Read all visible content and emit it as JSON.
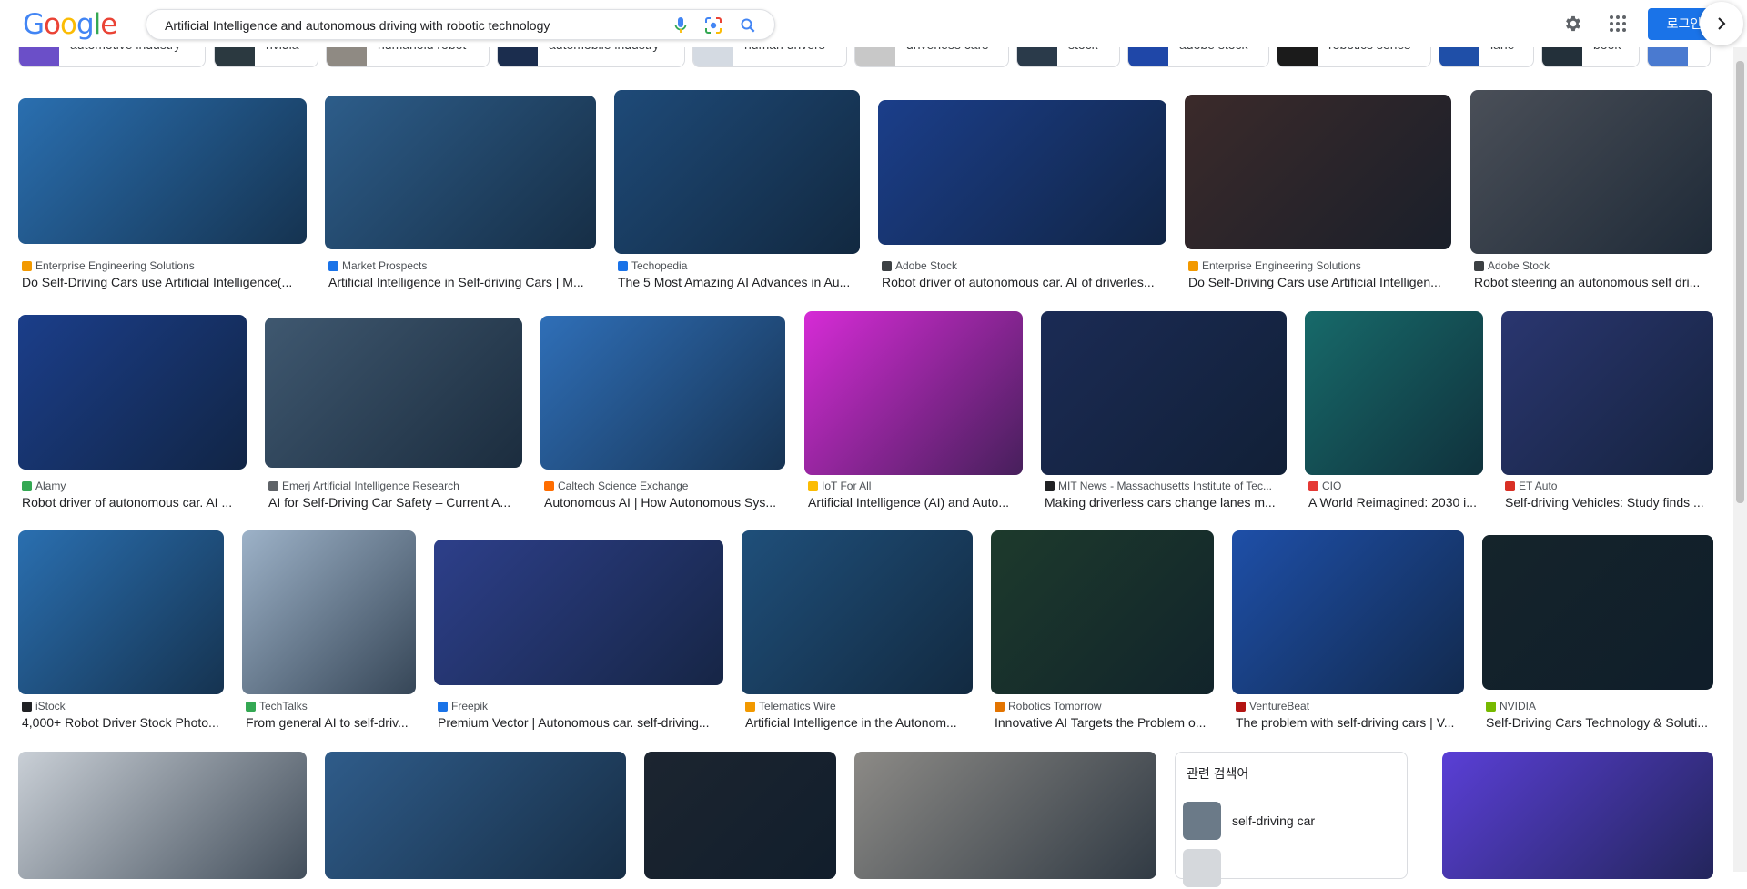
{
  "search": {
    "query": "Artificial Intelligence and autonomous driving with robotic technology",
    "login_label": "로그인"
  },
  "chips": [
    {
      "label": "automotive industry"
    },
    {
      "label": "nvidia"
    },
    {
      "label": "humanoid robot"
    },
    {
      "label": "automobile industry"
    },
    {
      "label": "human drivers"
    },
    {
      "label": "driverless cars"
    },
    {
      "label": "stock"
    },
    {
      "label": "adobe stock"
    },
    {
      "label": "robotics series"
    },
    {
      "label": "lane"
    },
    {
      "label": "book"
    }
  ],
  "results": [
    {
      "source": "Enterprise Engineering Solutions",
      "title": "Do Self-Driving Cars use Artificial Intelligence(...",
      "color": "#2a6fb0"
    },
    {
      "source": "Market Prospects",
      "title": "Artificial Intelligence in Self-driving Cars | M...",
      "color": "#2d5d8a"
    },
    {
      "source": "Techopedia",
      "title": "The 5 Most Amazing AI Advances in Au...",
      "color": "#1e4a78"
    },
    {
      "source": "Adobe Stock",
      "title": "Robot driver of autonomous car. AI of driverles...",
      "color": "#1b3e8a"
    },
    {
      "source": "Enterprise Engineering Solutions",
      "title": "Do Self-Driving Cars use Artificial Intelligen...",
      "color": "#3b2a2a"
    },
    {
      "source": "Adobe Stock",
      "title": "Robot steering an autonomous self dri...",
      "color": "#4a4f58"
    },
    {
      "source": "Alamy",
      "title": "Robot driver of autonomous car. AI ...",
      "color": "#1b3e8a"
    },
    {
      "source": "Emerj Artificial Intelligence Research",
      "title": "AI for Self-Driving Car Safety – Current A...",
      "color": "#3f5870"
    },
    {
      "source": "Caltech Science Exchange",
      "title": "Autonomous AI | How Autonomous Sys...",
      "color": "#2f6fb8"
    },
    {
      "source": "IoT For All",
      "title": "Artificial Intelligence (AI) and Auto...",
      "color": "#d62bd6"
    },
    {
      "source": "MIT News - Massachusetts Institute of Tec...",
      "title": "Making driverless cars change lanes m...",
      "color": "#1b2b55"
    },
    {
      "source": "CIO",
      "title": "A World Reimagined: 2030 i...",
      "color": "#176a6a"
    },
    {
      "source": "ET Auto",
      "title": "Self-driving Vehicles: Study finds ...",
      "color": "#2a3670"
    },
    {
      "source": "iStock",
      "title": "4,000+ Robot Driver Stock Photo...",
      "color": "#2a6fb0"
    },
    {
      "source": "TechTalks",
      "title": "From general AI to self-driv...",
      "color": "#9db2c8"
    },
    {
      "source": "Freepik",
      "title": "Premium Vector | Autonomous car. self-driving...",
      "color": "#2d3f8a"
    },
    {
      "source": "Telematics Wire",
      "title": "Artificial Intelligence in the Autonom...",
      "color": "#1f4f7a"
    },
    {
      "source": "Robotics Tomorrow",
      "title": "Innovative AI Targets the Problem o...",
      "color": "#1d3a2c"
    },
    {
      "source": "VentureBeat",
      "title": "The problem with self-driving cars | V...",
      "color": "#1e4fa8"
    },
    {
      "source": "NVIDIA",
      "title": "Self-Driving Cars Technology & Soluti...",
      "color": "#15242b"
    },
    {
      "source": "",
      "title": "",
      "color": "#c9cfd6"
    },
    {
      "source": "",
      "title": "",
      "color": "#2f5c8a"
    },
    {
      "source": "",
      "title": "",
      "color": "#1c2530"
    },
    {
      "source": "",
      "title": "",
      "color": "#8c8a86"
    },
    {
      "source": "",
      "title": "",
      "color": "#5a3fd6"
    }
  ],
  "related": {
    "heading": "관련 검색어",
    "items": [
      {
        "label": "self-driving car"
      }
    ]
  }
}
